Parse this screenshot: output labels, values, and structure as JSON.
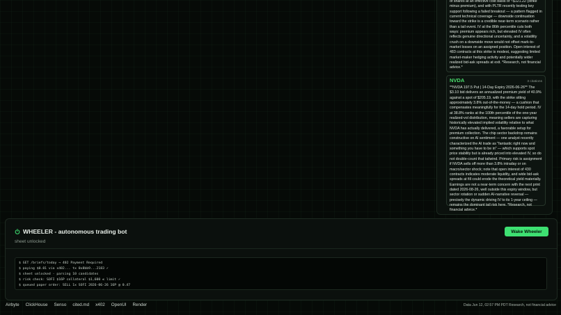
{
  "panel": {
    "cards": [
      {
        "ticker": "",
        "citations": "",
        "text": "of shares at an effective cost basis of ~$121.22 (strike minus premium), and with PLTR recently testing key support following a failed breakout — a pattern flagged in current technical coverage — downside continuation toward the strike is a credible near-term scenario rather than a tail event. IV at the 86th percentile cuts both ways: premium appears rich, but elevated IV often reflects genuine directional uncertainty, and a volatility crush on a downside move would not offset mark-to-market losses on an assigned position. Open interest of 483 contracts at this strike is modest, suggesting limited market-maker hedging activity and potentially wider realized bid-ask spreads at exit. *Research, not financial advice.*"
      },
      {
        "ticker": "NVDA",
        "citations": "3 citations",
        "text": "**NVDA 197.5 Put | 14-Day Expiry 2026-06-26** The $3.10 bid delivers an annualized premium yield of 40.9% against a spot of $205.19, with the strike sitting approximately 3.8% out-of-the-money — a cushion that compensates meaningfully for the 14-day hold period. IV at 38.8% ranks at the 100th percentile of the one-year realized-vol distribution, meaning sellers are capturing historically elevated implied volatility relative to what NVDA has actually delivered, a favorable setup for premium collection. The chip sector backdrop remains constructive on AI sentiment — one analyst recently characterized the AI trade as \"fantastic right now and something you have to be in\" — which supports spot price stability but is already priced into elevated IV, so do not double-count that tailwind. Primary risk is assignment if NVDA sells off more than 3.8% intraday or on macro/sector shock; note that open interest of 430 contracts indicates moderate liquidity, and wide bid-ask spreads at fill could erode the theoretical yield materially. Earnings are not a near-term concern with the next print dated 2026-08-26, well outside this expiry window, but sector rotation or sudden AI-narrative reversal — precisely the dynamic driving IV to its 1-year ceiling — remains the dominant tail risk here. *Research, not financial advice.*"
      }
    ]
  },
  "bot": {
    "title": "WHEELER - autonomous trading bot",
    "subtitle": "sheet unlocked",
    "button_label": "Wake Wheeler",
    "terminal_lines": [
      "$ GET /briefs/today → 402 Payment Required",
      "$ paying $0.01 via x402... tx 0x8bb9...2183 ✓",
      "$ sheet unlocked - parsing 10 candidates",
      "$ risk check: SOFI $16P collateral $1,600 ≤ limit ✓",
      "$ queued paper order: SELL 1x SOFI 2026-06-26 16P @ 0.47"
    ]
  },
  "footer": {
    "links": [
      "Airbyte",
      "ClickHouse",
      "Senso",
      "cited.md",
      "x402",
      "OpenUI",
      "Render"
    ],
    "right_text": "Data Jun 12, 02:57 PM PDT  Research, not financial advice"
  },
  "colors": {
    "accent": "#3ee072",
    "ticker": "#4ade6d",
    "background": "#060a07"
  },
  "icons": {
    "bot_status": "power-icon"
  }
}
